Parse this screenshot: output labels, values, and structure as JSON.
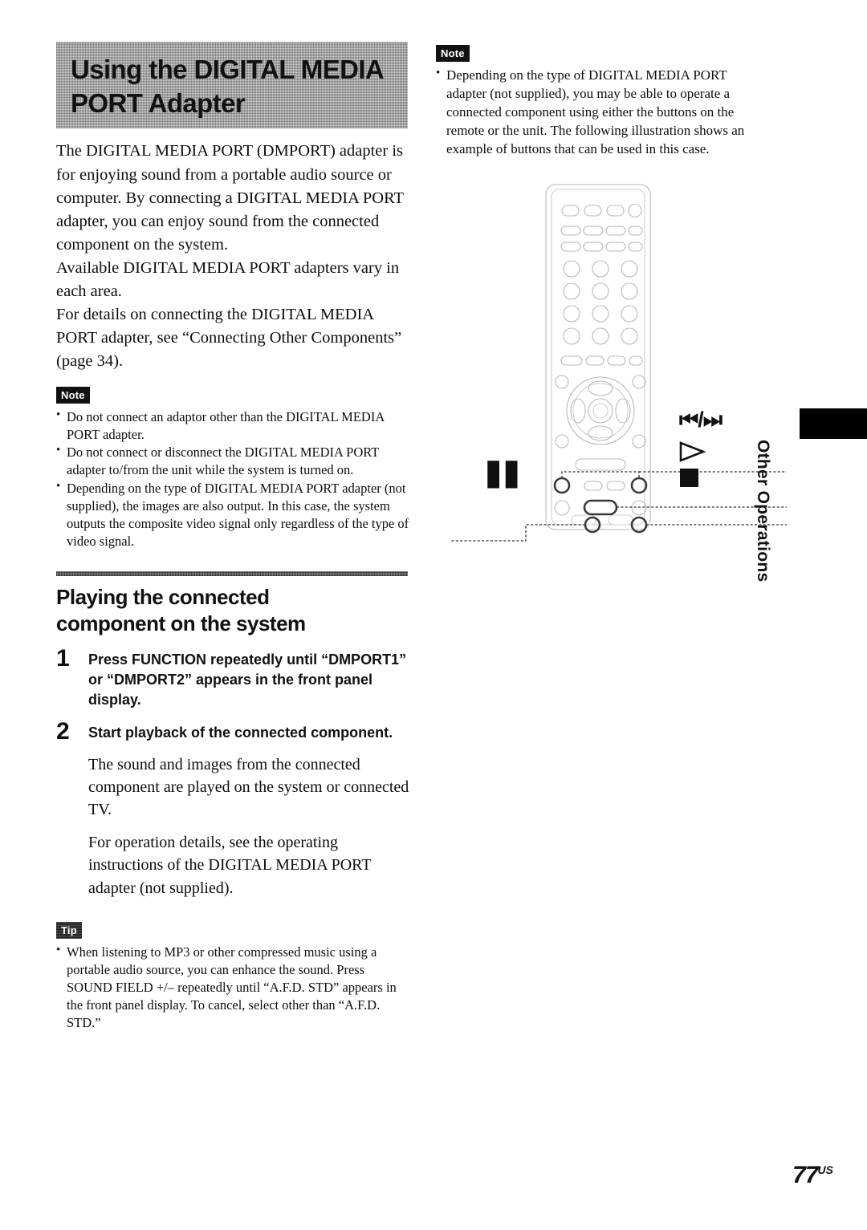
{
  "header": {
    "title_line1": "Using the DIGITAL MEDIA",
    "title_line2": "PORT Adapter"
  },
  "left_column": {
    "intro_paragraphs": [
      "The DIGITAL MEDIA PORT (DMPORT) adapter is for enjoying sound from a portable audio source or computer. By connecting a DIGITAL MEDIA PORT adapter, you can enjoy sound from the connected component on the system.",
      "Available DIGITAL MEDIA PORT adapters vary in each area.",
      "For details on connecting the DIGITAL MEDIA PORT adapter, see “Connecting Other Components” (page 34)."
    ],
    "note": {
      "badge": "Note",
      "items": [
        "Do not connect an adaptor other than the DIGITAL MEDIA PORT adapter.",
        "Do not connect or disconnect the DIGITAL MEDIA PORT adapter to/from the unit while the system is turned on.",
        "Depending on the type of DIGITAL MEDIA PORT adapter (not supplied), the images are also output. In this case, the system outputs the composite video signal only regardless of the type of video signal."
      ]
    },
    "section": {
      "heading_line1": "Playing the connected",
      "heading_line2": "component on the system",
      "steps": [
        {
          "number": "1",
          "instruction": "Press FUNCTION repeatedly until “DMPORT1” or “DMPORT2” appears in the front panel display.",
          "follow_ups": []
        },
        {
          "number": "2",
          "instruction": "Start playback of the connected component.",
          "follow_ups": [
            "The sound and images from the connected component are played on the system or connected TV.",
            "For operation details, see the operating instructions of the DIGITAL MEDIA PORT adapter (not supplied)."
          ]
        }
      ]
    },
    "tip": {
      "badge": "Tip",
      "items": [
        "When listening to MP3 or other compressed music using a portable audio source, you can enhance the sound. Press SOUND FIELD +/– repeatedly until “A.F.D. STD” appears in the front panel display. To cancel, select other than “A.F.D. STD.”"
      ]
    }
  },
  "right_column": {
    "note": {
      "badge": "Note",
      "items": [
        "Depending on the type of DIGITAL MEDIA PORT adapter (not supplied), you may be able to operate a connected component using either the buttons on the remote or the unit. The following illustration shows an example of buttons that can be used in this case."
      ]
    },
    "illustration": {
      "name": "remote-control-diagram",
      "callouts": [
        {
          "id": "pause",
          "symbol": "❘❘",
          "position": "left"
        },
        {
          "id": "previous-next",
          "symbol": "⏮/⏭",
          "position": "right"
        },
        {
          "id": "play",
          "symbol": "▷",
          "position": "right"
        },
        {
          "id": "stop",
          "symbol": "■",
          "position": "right"
        }
      ]
    }
  },
  "side_tab": {
    "label": "Other Operations"
  },
  "footer": {
    "page_number": "77",
    "page_suffix": "US"
  }
}
